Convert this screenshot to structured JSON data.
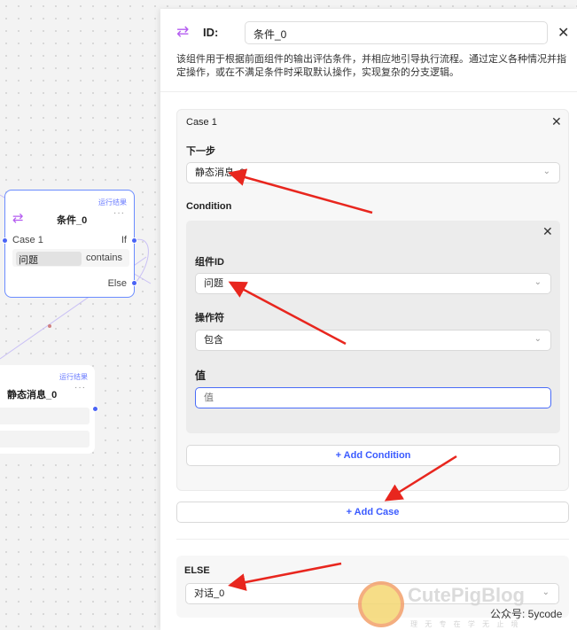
{
  "canvas": {
    "condition_node": {
      "run_label": "运行结果",
      "title": "条件_0",
      "case_label": "Case 1",
      "if_label": "If",
      "else_label": "Else",
      "field": "问题",
      "operator": "contains"
    },
    "message_node": {
      "run_label": "运行结果",
      "title": "静态消息_0"
    }
  },
  "panel": {
    "id_label": "ID:",
    "id_value": "条件_0",
    "description": "该组件用于根据前面组件的输出评估条件，并相应地引导执行流程。通过定义各种情况并指定操作，或在不满足条件时采取默认操作，实现复杂的分支逻辑。",
    "case": {
      "title": "Case 1",
      "next_label": "下一步",
      "next_value": "静态消息_0",
      "condition_label": "Condition",
      "component_id_label": "组件ID",
      "component_id_value": "问题",
      "operator_label": "操作符",
      "operator_value": "包含",
      "value_label": "值",
      "value_placeholder": "值",
      "add_condition": "+ Add Condition"
    },
    "add_case": "+ Add Case",
    "else": {
      "label": "ELSE",
      "value": "对话_0"
    }
  },
  "watermark": {
    "brand": "CutePigBlog",
    "account": "公众号: 5ycode",
    "subtitle": "理 无 专 在 学 无 止 境"
  },
  "colors": {
    "accent": "#3b5bff",
    "node_border": "#6b8cff",
    "arrow": "#e8261e",
    "icon": "#b45cf0"
  }
}
